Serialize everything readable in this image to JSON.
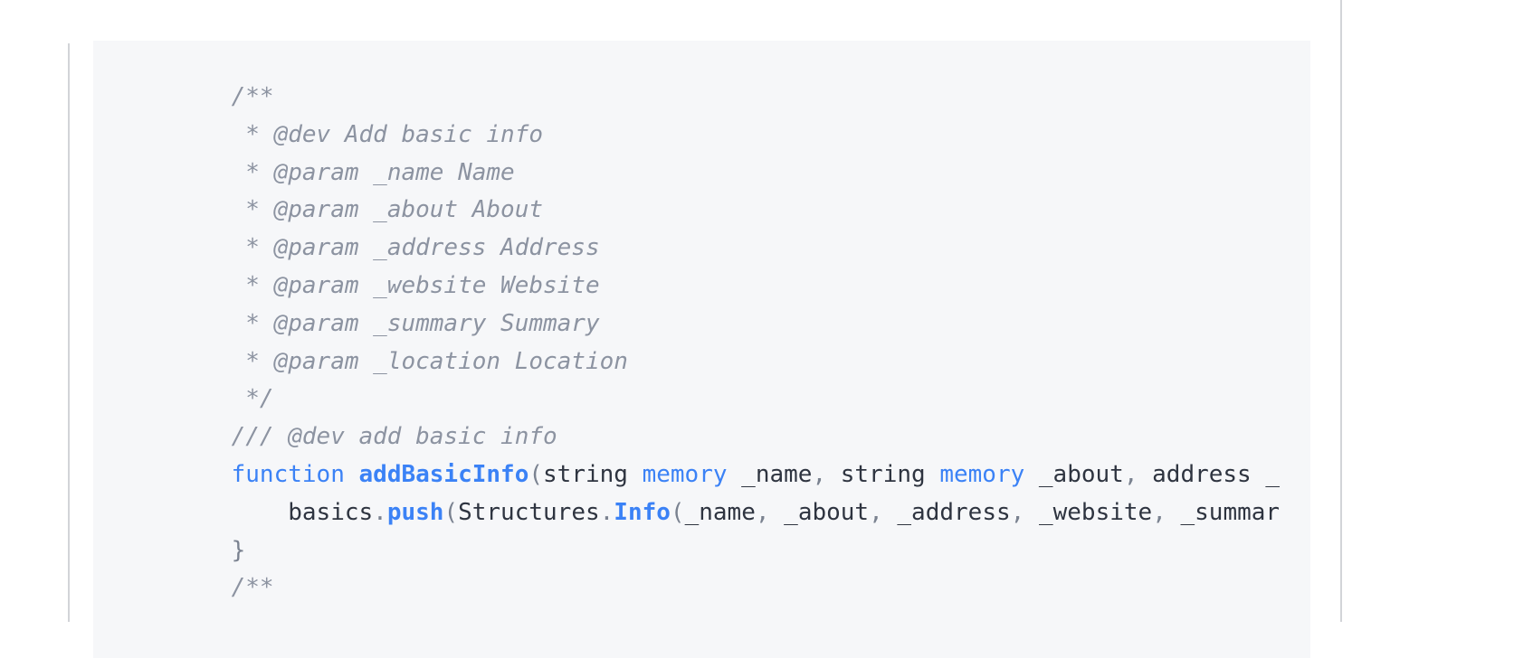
{
  "theme": {
    "page_background": "#ffffff",
    "code_background": "#f6f7f9",
    "rule_color": "#d2d4d8",
    "comment_color": "#8c93a1",
    "keyword_color": "#3b82f6",
    "function_color": "#3b82f6",
    "plain_color": "#2e3440",
    "punctuation_color": "#7a8290"
  },
  "code": {
    "language": "solidity",
    "lines": [
      {
        "index": 0,
        "text": "    /**",
        "tokens": [
          {
            "t": "    ",
            "k": "plain"
          },
          {
            "t": "/**",
            "k": "cmt"
          }
        ]
      },
      {
        "index": 1,
        "text": "     * @dev Add basic info",
        "tokens": [
          {
            "t": "     ",
            "k": "plain"
          },
          {
            "t": "* @dev Add basic info",
            "k": "cmt"
          }
        ]
      },
      {
        "index": 2,
        "text": "     * @param _name Name",
        "tokens": [
          {
            "t": "     ",
            "k": "plain"
          },
          {
            "t": "* @param _name Name",
            "k": "cmt"
          }
        ]
      },
      {
        "index": 3,
        "text": "     * @param _about About",
        "tokens": [
          {
            "t": "     ",
            "k": "plain"
          },
          {
            "t": "* @param _about About",
            "k": "cmt"
          }
        ]
      },
      {
        "index": 4,
        "text": "     * @param _address Address",
        "tokens": [
          {
            "t": "     ",
            "k": "plain"
          },
          {
            "t": "* @param _address Address",
            "k": "cmt"
          }
        ]
      },
      {
        "index": 5,
        "text": "     * @param _website Website",
        "tokens": [
          {
            "t": "     ",
            "k": "plain"
          },
          {
            "t": "* @param _website Website",
            "k": "cmt"
          }
        ]
      },
      {
        "index": 6,
        "text": "     * @param _summary Summary",
        "tokens": [
          {
            "t": "     ",
            "k": "plain"
          },
          {
            "t": "* @param _summary Summary",
            "k": "cmt"
          }
        ]
      },
      {
        "index": 7,
        "text": "     * @param _location Location",
        "tokens": [
          {
            "t": "     ",
            "k": "plain"
          },
          {
            "t": "* @param _location Location",
            "k": "cmt"
          }
        ]
      },
      {
        "index": 8,
        "text": "     */",
        "tokens": [
          {
            "t": "     ",
            "k": "plain"
          },
          {
            "t": "*/",
            "k": "cmt"
          }
        ]
      },
      {
        "index": 9,
        "text": "    /// @dev add basic info",
        "tokens": [
          {
            "t": "    ",
            "k": "plain"
          },
          {
            "t": "/// @dev add basic info",
            "k": "cmt"
          }
        ]
      },
      {
        "index": 10,
        "text": "    function addBasicInfo(string memory _name, string memory _about, address _",
        "tokens": [
          {
            "t": "    ",
            "k": "plain"
          },
          {
            "t": "function",
            "k": "kw"
          },
          {
            "t": " ",
            "k": "plain"
          },
          {
            "t": "addBasicInfo",
            "k": "fn"
          },
          {
            "t": "(",
            "k": "punc"
          },
          {
            "t": "string ",
            "k": "plain"
          },
          {
            "t": "memory",
            "k": "kw"
          },
          {
            "t": " _name",
            "k": "plain"
          },
          {
            "t": ",",
            "k": "punc"
          },
          {
            "t": " string ",
            "k": "plain"
          },
          {
            "t": "memory",
            "k": "kw"
          },
          {
            "t": " _about",
            "k": "plain"
          },
          {
            "t": ",",
            "k": "punc"
          },
          {
            "t": " address _",
            "k": "plain"
          }
        ]
      },
      {
        "index": 11,
        "text": "        basics.push(Structures.Info(_name, _about, _address, _website, _summar",
        "tokens": [
          {
            "t": "        ",
            "k": "plain"
          },
          {
            "t": "basics",
            "k": "plain"
          },
          {
            "t": ".",
            "k": "punc"
          },
          {
            "t": "push",
            "k": "fn"
          },
          {
            "t": "(",
            "k": "punc"
          },
          {
            "t": "Structures",
            "k": "plain"
          },
          {
            "t": ".",
            "k": "punc"
          },
          {
            "t": "Info",
            "k": "fn"
          },
          {
            "t": "(",
            "k": "punc"
          },
          {
            "t": "_name",
            "k": "plain"
          },
          {
            "t": ",",
            "k": "punc"
          },
          {
            "t": " _about",
            "k": "plain"
          },
          {
            "t": ",",
            "k": "punc"
          },
          {
            "t": " _address",
            "k": "plain"
          },
          {
            "t": ",",
            "k": "punc"
          },
          {
            "t": " _website",
            "k": "plain"
          },
          {
            "t": ",",
            "k": "punc"
          },
          {
            "t": " _summar",
            "k": "plain"
          }
        ]
      },
      {
        "index": 12,
        "text": "    }",
        "tokens": [
          {
            "t": "    ",
            "k": "plain"
          },
          {
            "t": "}",
            "k": "punc"
          }
        ]
      },
      {
        "index": 13,
        "text": "    /**",
        "tokens": [
          {
            "t": "    ",
            "k": "plain"
          },
          {
            "t": "/**",
            "k": "cmt"
          }
        ]
      }
    ]
  }
}
